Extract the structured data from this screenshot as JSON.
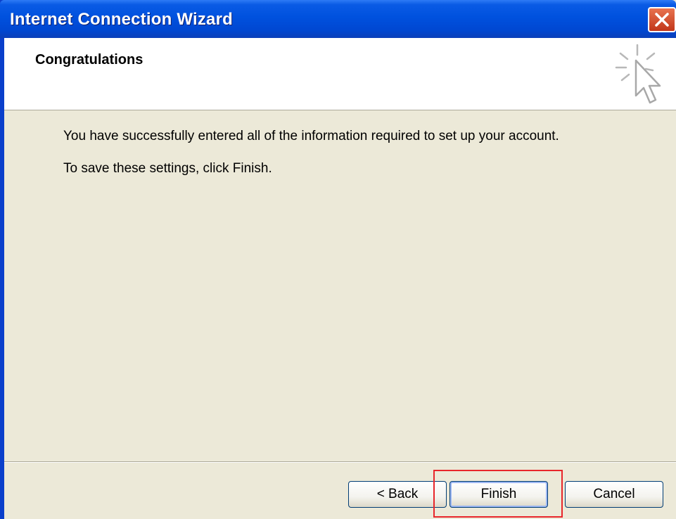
{
  "window": {
    "title": "Internet Connection Wizard"
  },
  "header": {
    "title": "Congratulations",
    "icon": "wizard-cursor-icon"
  },
  "body": {
    "message1": "You have successfully entered all of the information required to set up your account.",
    "message2": "To save these settings, click Finish."
  },
  "buttons": {
    "back": "< Back",
    "finish": "Finish",
    "cancel": "Cancel"
  },
  "colors": {
    "titlebar": "#0051DE",
    "dialog_bg": "#ECE9D8",
    "highlight": "#E8262B",
    "close": "#C1361A"
  }
}
